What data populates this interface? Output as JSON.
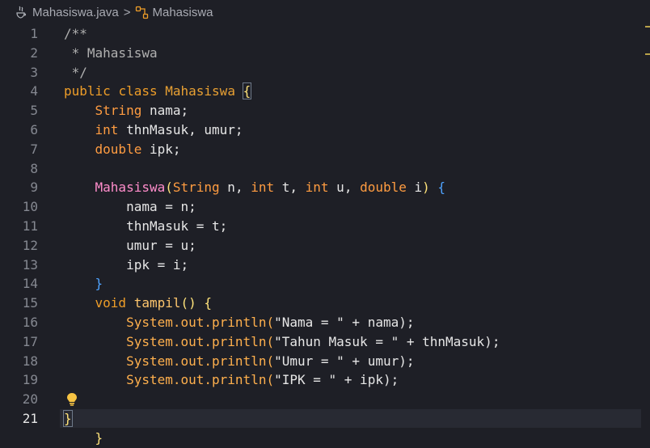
{
  "breadcrumb": {
    "file": "Mahasiswa.java",
    "symbol": "Mahasiswa",
    "separator": ">"
  },
  "code": {
    "line_numbers": [
      "1",
      "2",
      "3",
      "4",
      "5",
      "6",
      "7",
      "8",
      "9",
      "10",
      "11",
      "12",
      "13",
      "14",
      "15",
      "16",
      "17",
      "18",
      "19",
      "20",
      "21"
    ],
    "lines": {
      "l1": "/**",
      "l2": " * Mahasiswa",
      "l3": " */",
      "l4_a": "public",
      "l4_b": "class",
      "l4_c": "Mahasiswa",
      "l4_d": "{",
      "l5_type": "String",
      "l5_rest": " nama;",
      "l6_type": "int",
      "l6_rest": " thnMasuk, umur;",
      "l7_type": "double",
      "l7_rest": " ipk;",
      "l9_fn": "Mahasiswa",
      "l9_open": "(",
      "l9_t1": "String",
      "l9_p1": " n, ",
      "l9_t2": "int",
      "l9_p2": " t, ",
      "l9_t3": "int",
      "l9_p3": " u, ",
      "l9_t4": "double",
      "l9_p4": " i",
      "l9_close": ")",
      "l9_brace": " {",
      "l10": "nama = n;",
      "l11": "thnMasuk = t;",
      "l12": "umur = u;",
      "l13": "ipk = i;",
      "l14": "}",
      "l15_kw": "void",
      "l15_fn": " tampil",
      "l15_rest": "() {",
      "l16_sys": "System.out.println(",
      "l16_str": "\"Nama = \"",
      "l16_rest": " + nama);",
      "l17_sys": "System.out.println(",
      "l17_str": "\"Tahun Masuk = \"",
      "l17_rest": " + thnMasuk);",
      "l18_sys": "System.out.println(",
      "l18_str": "\"Umur = \"",
      "l18_rest": " + umur);",
      "l19_sys": "System.out.println(",
      "l19_str": "\"IPK = \"",
      "l19_rest": " + ipk);",
      "l20": "}",
      "l21": "}"
    }
  },
  "icons": {
    "file": "java-file-icon",
    "symbol": "class-symbol-icon",
    "lightbulb": "lightbulb-icon"
  },
  "colors": {
    "background": "#1e1f26",
    "current_line": "#282a33",
    "keyword": "#ee9d28",
    "string": "#e7e7e7",
    "lightbulb": "#f6c343"
  }
}
